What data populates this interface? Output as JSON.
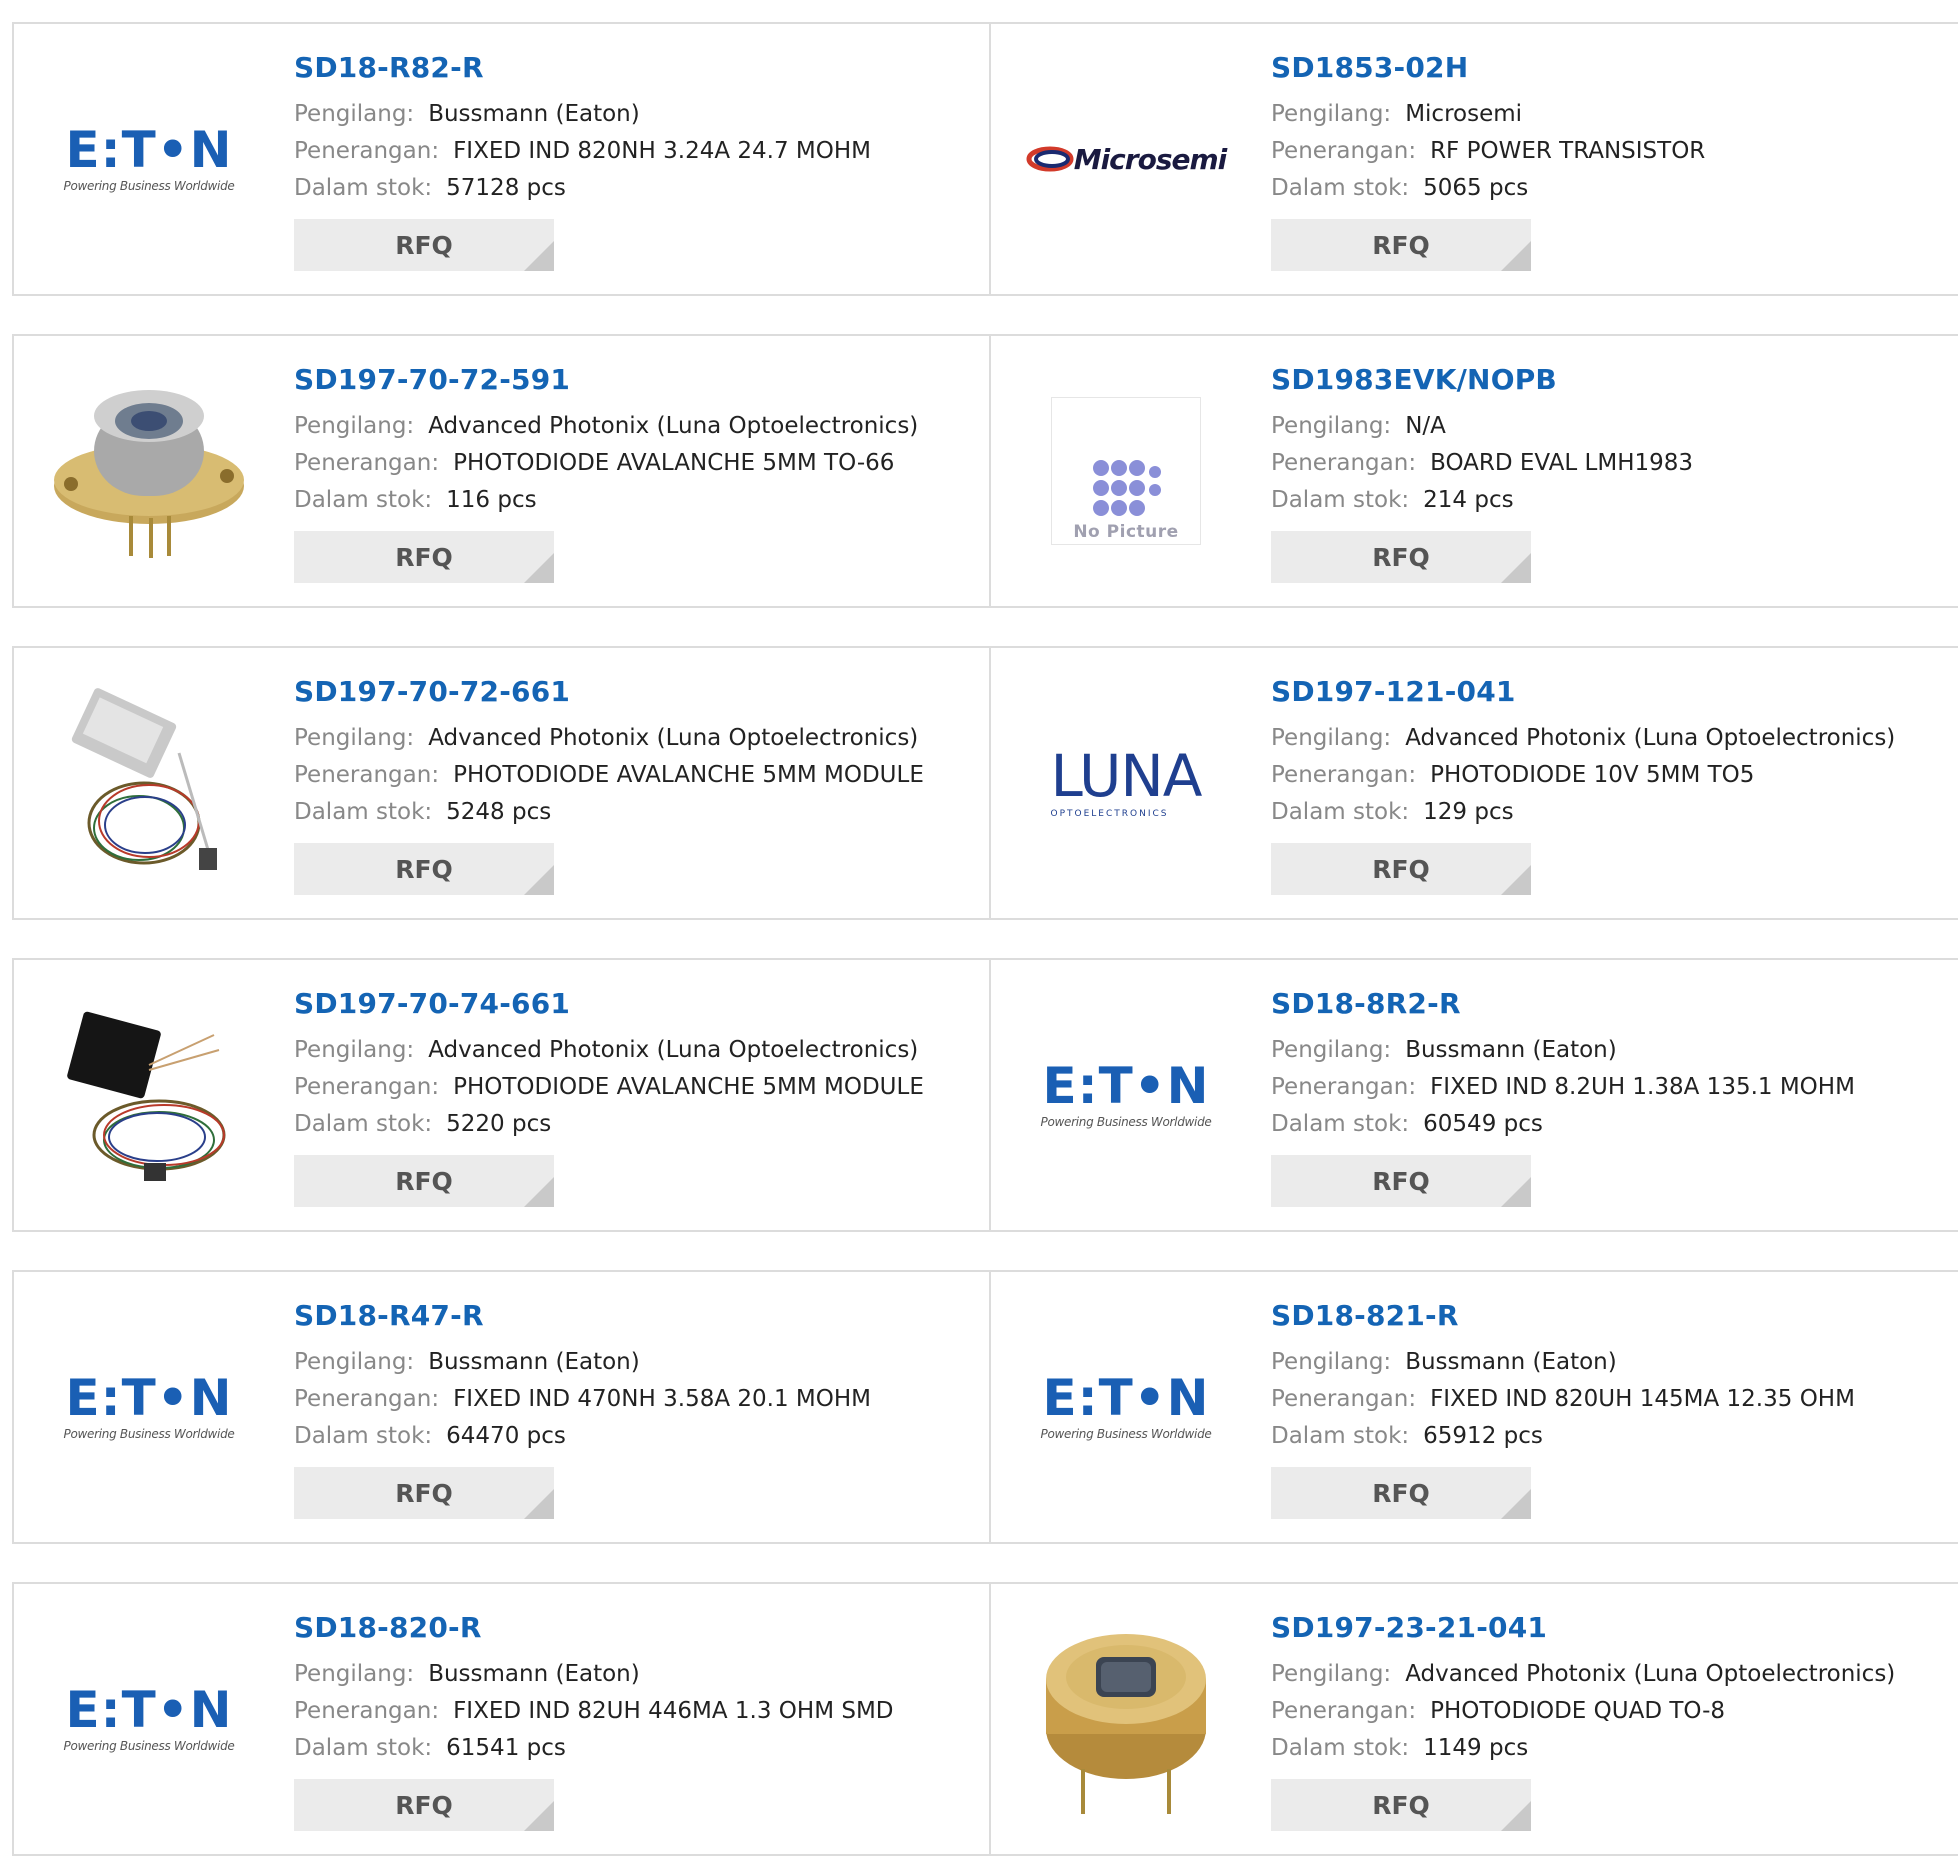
{
  "labels": {
    "manufacturer": "Pengilang:",
    "description": "Penerangan:",
    "stock": "Dalam stok:",
    "rfq": "RFQ",
    "no_picture": "No Picture"
  },
  "products": [
    {
      "part_number": "SD18-R82-R",
      "manufacturer": "Bussmann (Eaton)",
      "description": "FIXED IND 820NH 3.24A 24.7 MOHM",
      "stock": "57128 pcs",
      "image": "eaton-logo"
    },
    {
      "part_number": "SD1853-02H",
      "manufacturer": "Microsemi",
      "description": "RF POWER TRANSISTOR",
      "stock": "5065 pcs",
      "image": "microsemi-logo"
    },
    {
      "part_number": "SD197-70-72-591",
      "manufacturer": "Advanced Photonix (Luna Optoelectronics)",
      "description": "PHOTODIODE AVALANCHE 5MM TO-66",
      "stock": "116 pcs",
      "image": "photodiode-to66-photo"
    },
    {
      "part_number": "SD1983EVK/NOPB",
      "manufacturer": "N/A",
      "description": "BOARD EVAL LMH1983",
      "stock": "214 pcs",
      "image": "no-picture-placeholder"
    },
    {
      "part_number": "SD197-70-72-661",
      "manufacturer": "Advanced Photonix (Luna Optoelectronics)",
      "description": "PHOTODIODE AVALANCHE 5MM MODULE",
      "stock": "5248 pcs",
      "image": "photodiode-module-photo"
    },
    {
      "part_number": "SD197-121-041",
      "manufacturer": "Advanced Photonix (Luna Optoelectronics)",
      "description": "PHOTODIODE 10V 5MM TO5",
      "stock": "129 pcs",
      "image": "luna-logo"
    },
    {
      "part_number": "SD197-70-74-661",
      "manufacturer": "Advanced Photonix (Luna Optoelectronics)",
      "description": "PHOTODIODE AVALANCHE 5MM MODULE",
      "stock": "5220 pcs",
      "image": "photodiode-module-black-photo"
    },
    {
      "part_number": "SD18-8R2-R",
      "manufacturer": "Bussmann (Eaton)",
      "description": "FIXED IND 8.2UH 1.38A 135.1 MOHM",
      "stock": "60549 pcs",
      "image": "eaton-logo"
    },
    {
      "part_number": "SD18-R47-R",
      "manufacturer": "Bussmann (Eaton)",
      "description": "FIXED IND 470NH 3.58A 20.1 MOHM",
      "stock": "64470 pcs",
      "image": "eaton-logo"
    },
    {
      "part_number": "SD18-821-R",
      "manufacturer": "Bussmann (Eaton)",
      "description": "FIXED IND 820UH 145MA 12.35 OHM",
      "stock": "65912 pcs",
      "image": "eaton-logo"
    },
    {
      "part_number": "SD18-820-R",
      "manufacturer": "Bussmann (Eaton)",
      "description": "FIXED IND 82UH 446MA 1.3 OHM SMD",
      "stock": "61541 pcs",
      "image": "eaton-logo"
    },
    {
      "part_number": "SD197-23-21-041",
      "manufacturer": "Advanced Photonix (Luna Optoelectronics)",
      "description": "PHOTODIODE QUAD TO-8",
      "stock": "1149 pcs",
      "image": "photodiode-to8-photo"
    }
  ],
  "logos": {
    "eaton_word": "E:T•N",
    "eaton_tag": "Powering Business Worldwide",
    "microsemi_word": "Microsemi",
    "luna_word": "LUNA",
    "luna_sub": "OPTOELECTRONICS"
  },
  "colors": {
    "part_number": "#1464b4",
    "label": "#888888",
    "value": "#222222",
    "rfq_bg": "#ebebeb",
    "border": "#dcdcdc"
  }
}
